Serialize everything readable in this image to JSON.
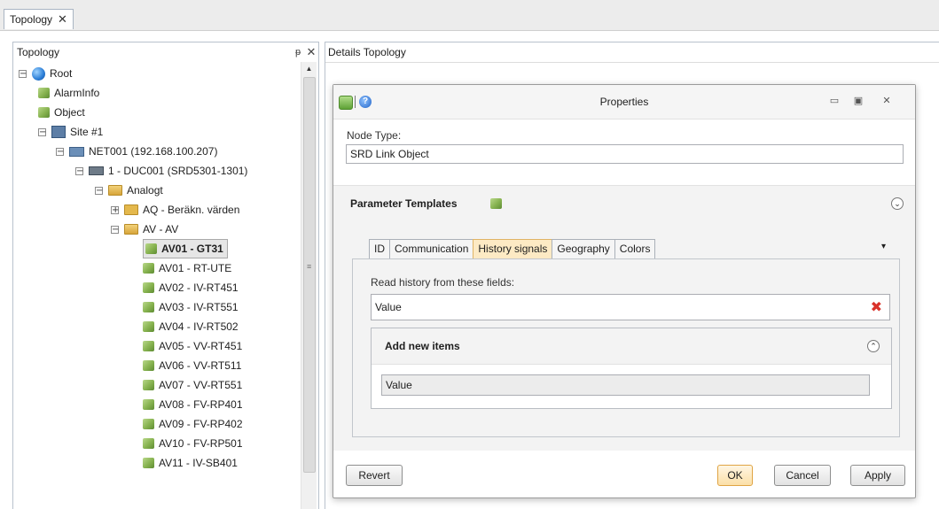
{
  "doc_tab": {
    "label": "Topology",
    "close": "✕"
  },
  "left_panel": {
    "title": "Topology",
    "pin": "ᵽ",
    "close": "✕"
  },
  "tree": [
    {
      "label": "Root",
      "toggle": "⊟",
      "icon": "globe-icon",
      "level": 0
    },
    {
      "label": "AlarmInfo",
      "toggle": "",
      "icon": "cube-icon",
      "level": 1
    },
    {
      "label": "Object",
      "toggle": "",
      "icon": "cube-icon",
      "level": 1
    },
    {
      "label": "Site #1",
      "toggle": "⊟",
      "icon": "site-icon",
      "level": 1
    },
    {
      "label": "NET001 (192.168.100.207)",
      "toggle": "⊟",
      "icon": "network-icon",
      "level": 2
    },
    {
      "label": "1 - DUC001 (SRD5301-1301)",
      "toggle": "⊟",
      "icon": "controller-icon",
      "level": 3
    },
    {
      "label": "Analogt",
      "toggle": "⊟",
      "icon": "folder-open-icon",
      "level": 4
    },
    {
      "label": "AQ - Beräkn. värden",
      "toggle": "⊞",
      "icon": "folder-icon",
      "level": 5
    },
    {
      "label": "AV - AV",
      "toggle": "⊟",
      "icon": "folder-open-icon",
      "level": 5
    },
    {
      "label": "AV01 - GT31",
      "toggle": "",
      "icon": "cube-icon",
      "level": 6,
      "selected": true
    },
    {
      "label": "AV01 - RT-UTE",
      "toggle": "",
      "icon": "cube-icon",
      "level": 6
    },
    {
      "label": "AV02 - IV-RT451",
      "toggle": "",
      "icon": "cube-icon",
      "level": 6
    },
    {
      "label": "AV03 - IV-RT551",
      "toggle": "",
      "icon": "cube-icon",
      "level": 6
    },
    {
      "label": "AV04 - IV-RT502",
      "toggle": "",
      "icon": "cube-icon",
      "level": 6
    },
    {
      "label": "AV05 - VV-RT451",
      "toggle": "",
      "icon": "cube-icon",
      "level": 6
    },
    {
      "label": "AV06 - VV-RT511",
      "toggle": "",
      "icon": "cube-icon",
      "level": 6
    },
    {
      "label": "AV07 - VV-RT551",
      "toggle": "",
      "icon": "cube-icon",
      "level": 6
    },
    {
      "label": "AV08 - FV-RP401",
      "toggle": "",
      "icon": "cube-icon",
      "level": 6
    },
    {
      "label": "AV09 - FV-RP402",
      "toggle": "",
      "icon": "cube-icon",
      "level": 6
    },
    {
      "label": "AV10 - FV-RP501",
      "toggle": "",
      "icon": "cube-icon",
      "level": 6
    },
    {
      "label": "AV11 - IV-SB401",
      "toggle": "",
      "icon": "cube-icon",
      "level": 6
    }
  ],
  "right_panel": {
    "title": "Details Topology"
  },
  "dialog": {
    "title": "Properties",
    "help_glyph": "?",
    "window_buttons": {
      "minimize": "▭",
      "maximize": "▣",
      "close": "✕"
    },
    "node_type_label": "Node Type:",
    "node_type_value": "SRD Link Object",
    "param_templates_label": "Parameter Templates",
    "collapse_glyph": "⌄",
    "tabs": [
      {
        "label": "ID",
        "active": false
      },
      {
        "label": "Communication",
        "active": false
      },
      {
        "label": "History signals",
        "active": true
      },
      {
        "label": "Geography",
        "active": false
      },
      {
        "label": "Colors",
        "active": false
      }
    ],
    "tab_overflow_glyph": "▾",
    "read_history_label": "Read history from these fields:",
    "history_field_value": "Value",
    "delete_glyph": "✖",
    "add_new_items_label": "Add new items",
    "expand_glyph": "⌃",
    "add_item_value": "Value",
    "buttons": {
      "revert": "Revert",
      "ok": "OK",
      "cancel": "Cancel",
      "apply": "Apply"
    }
  },
  "colors": {
    "active_tab": "#fdeac4",
    "delete": "#d9322a",
    "cube": "#86b24f"
  }
}
